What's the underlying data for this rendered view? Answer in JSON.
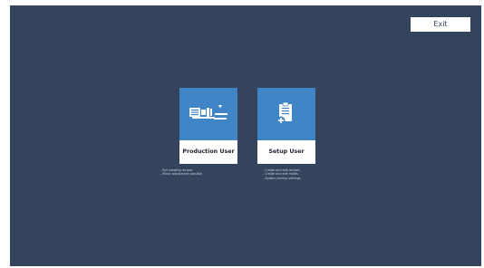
{
  "header": {
    "exit_label": "Exit"
  },
  "tiles": [
    {
      "label": "Production User",
      "icon": "machine-icon",
      "description": [
        "Run existing recipes",
        "Minor adjustment possible"
      ]
    },
    {
      "label": "Setup User",
      "icon": "clipboard-add-icon",
      "description": [
        "Create and edit recipes",
        "Create and edit molds",
        "System startup settings"
      ]
    }
  ],
  "colors": {
    "background": "#34445c",
    "tile_accent": "#3f84c4",
    "tile_label_bg": "#ffffff",
    "button_bg": "#ffffff"
  }
}
